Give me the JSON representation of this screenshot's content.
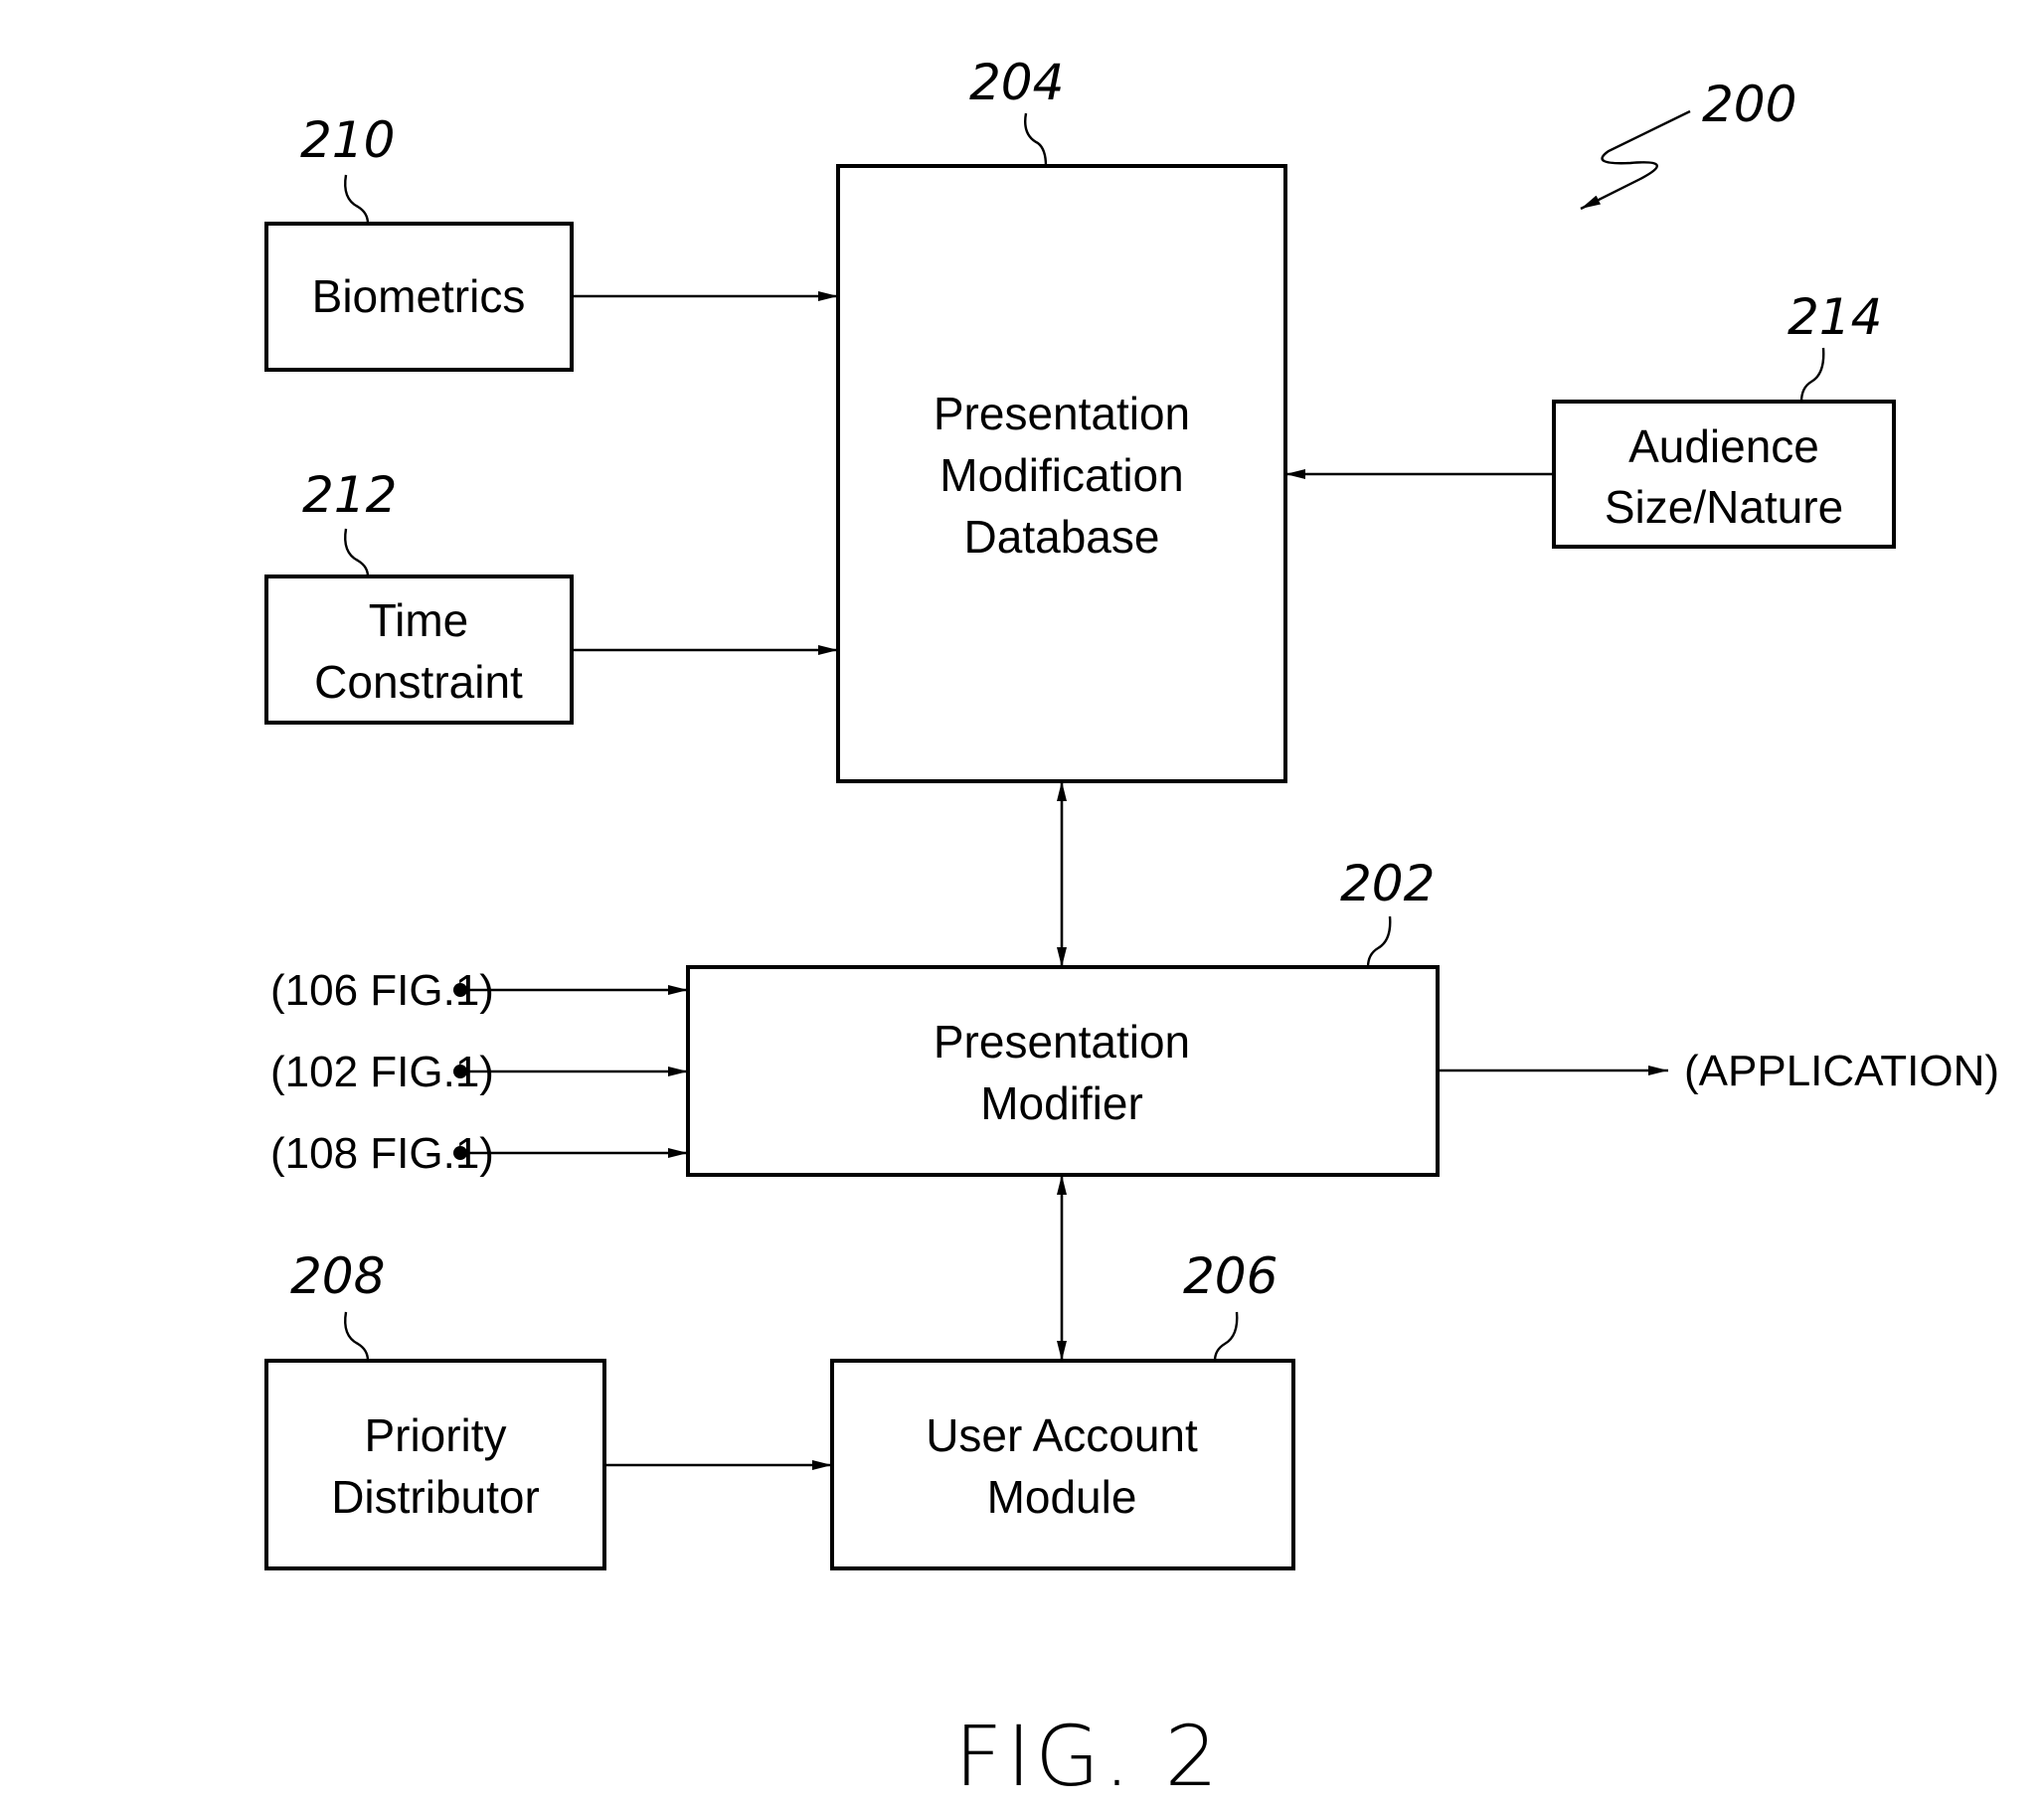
{
  "figure": {
    "caption": "FIG. 2",
    "reference": "200"
  },
  "blocks": {
    "biometrics": {
      "ref": "210",
      "lines": [
        "Biometrics"
      ]
    },
    "time_constraint": {
      "ref": "212",
      "lines": [
        "Time",
        "Constraint"
      ]
    },
    "pm_database": {
      "ref": "204",
      "lines": [
        "Presentation",
        "Modification",
        "Database"
      ]
    },
    "audience": {
      "ref": "214",
      "lines": [
        "Audience",
        "Size/Nature"
      ]
    },
    "pres_modifier": {
      "ref": "202",
      "lines": [
        "Presentation",
        "Modifier"
      ]
    },
    "priority": {
      "ref": "208",
      "lines": [
        "Priority",
        "Distributor"
      ]
    },
    "user_account": {
      "ref": "206",
      "lines": [
        "User Account",
        "Module"
      ]
    }
  },
  "external_inputs": [
    "(106 FIG.1)",
    "(102 FIG.1)",
    "(108 FIG.1)"
  ],
  "output_label": "(APPLICATION)"
}
